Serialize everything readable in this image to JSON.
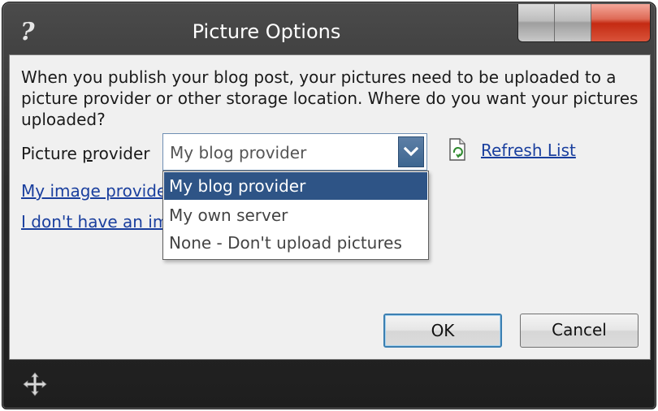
{
  "window": {
    "title": "Picture Options",
    "help_glyph": "?"
  },
  "content": {
    "intro": "When you publish your blog post, your pictures need to be uploaded to a picture provider or other storage location. Where do you want your pictures uploaded?",
    "provider_label_pre": "Picture ",
    "provider_label_access": "p",
    "provider_label_post": "rovider",
    "combo_value": "My blog provider",
    "refresh_label": "Refresh List",
    "link_image_provider": "My image provider",
    "link_no_image": "I don't have an image provider"
  },
  "dropdown": {
    "options": [
      {
        "label": "My blog provider",
        "selected": true
      },
      {
        "label": "My own server",
        "selected": false
      },
      {
        "label": "None - Don't upload pictures",
        "selected": false
      }
    ]
  },
  "buttons": {
    "ok": "OK",
    "cancel": "Cancel"
  },
  "icons": {
    "help": "help-icon",
    "minimize": "minimize-button",
    "maximize": "maximize-button",
    "close": "close-button",
    "dropdown_arrow": "chevron-down-icon",
    "refresh": "refresh-icon",
    "move": "move-icon"
  },
  "colors": {
    "selection": "#2e5486",
    "link": "#1a3f9e",
    "close_button": "#c42a12"
  }
}
